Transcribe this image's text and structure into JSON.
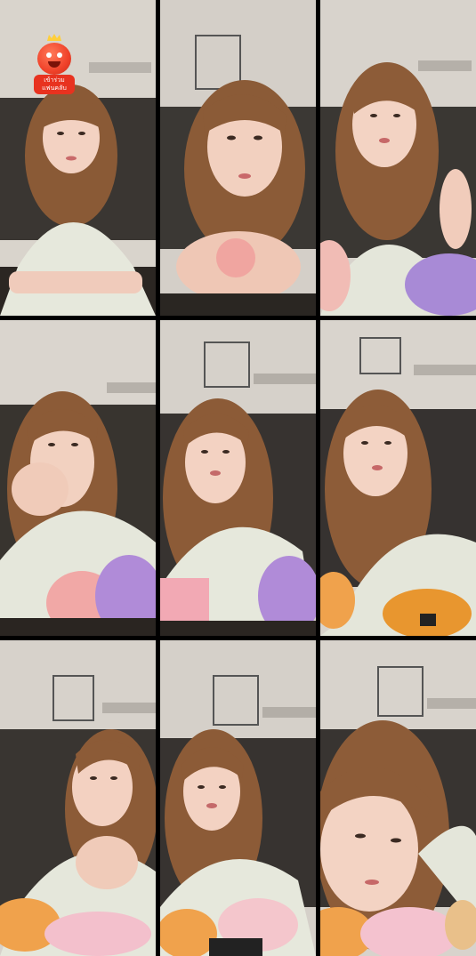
{
  "stream_grid": {
    "columns": 3,
    "rows": 3,
    "tiles": [
      {
        "name": "tile-1"
      },
      {
        "name": "tile-2"
      },
      {
        "name": "tile-3"
      },
      {
        "name": "tile-4"
      },
      {
        "name": "tile-5"
      },
      {
        "name": "tile-6"
      },
      {
        "name": "tile-7"
      },
      {
        "name": "tile-8"
      },
      {
        "name": "tile-9"
      }
    ]
  },
  "overlay_badge": {
    "line1": "เข้าร่วม",
    "line2": "แฟนคลับ",
    "icon": "mascot-crown-icon",
    "color": "#e8321f"
  },
  "colors": {
    "background": "#000000",
    "hair": "#8a5a36",
    "skin": "#f3d2c2",
    "shirt": "#e6e8dc",
    "ceiling": "#dcd7d0"
  }
}
